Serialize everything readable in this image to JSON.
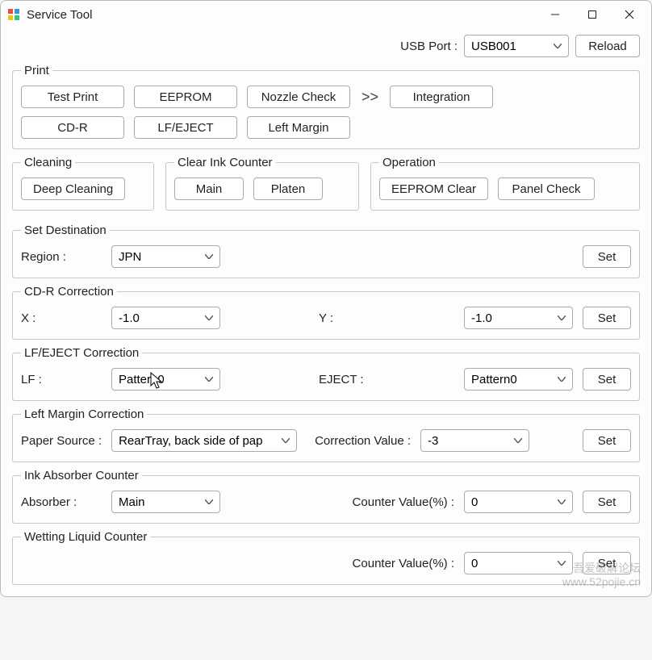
{
  "window": {
    "title": "Service Tool"
  },
  "top": {
    "usb_port_label": "USB Port :",
    "usb_port_value": "USB001",
    "reload": "Reload"
  },
  "print": {
    "legend": "Print",
    "test_print": "Test Print",
    "eeprom": "EEPROM",
    "nozzle_check": "Nozzle Check",
    "integration": "Integration",
    "cdr": "CD-R",
    "lf_eject": "LF/EJECT",
    "left_margin": "Left Margin",
    "arrows": ">>"
  },
  "cleaning": {
    "legend": "Cleaning",
    "deep_cleaning": "Deep Cleaning"
  },
  "clear_ink": {
    "legend": "Clear Ink Counter",
    "main": "Main",
    "platen": "Platen"
  },
  "operation": {
    "legend": "Operation",
    "eeprom_clear": "EEPROM Clear",
    "panel_check": "Panel Check"
  },
  "set_dest": {
    "legend": "Set Destination",
    "region_label": "Region :",
    "region_value": "JPN",
    "set": "Set"
  },
  "cdr_corr": {
    "legend": "CD-R Correction",
    "x_label": "X :",
    "x_value": "-1.0",
    "y_label": "Y :",
    "y_value": "-1.0",
    "set": "Set"
  },
  "lf_corr": {
    "legend": "LF/EJECT Correction",
    "lf_label": "LF :",
    "lf_value": "Pattern0",
    "eject_label": "EJECT :",
    "eject_value": "Pattern0",
    "set": "Set"
  },
  "left_margin_corr": {
    "legend": "Left Margin Correction",
    "paper_source_label": "Paper Source :",
    "paper_source_value": "RearTray, back side of pap",
    "corr_value_label": "Correction Value :",
    "corr_value": "-3",
    "set": "Set"
  },
  "ink_absorber": {
    "legend": "Ink Absorber Counter",
    "absorber_label": "Absorber :",
    "absorber_value": "Main",
    "counter_label": "Counter Value(%) :",
    "counter_value": "0",
    "set": "Set"
  },
  "wetting": {
    "legend": "Wetting Liquid Counter",
    "counter_label": "Counter Value(%) :",
    "counter_value": "0",
    "set": "Set"
  },
  "watermark": {
    "line1": "吾爱破解论坛",
    "line2": "www.52pojie.cn"
  }
}
